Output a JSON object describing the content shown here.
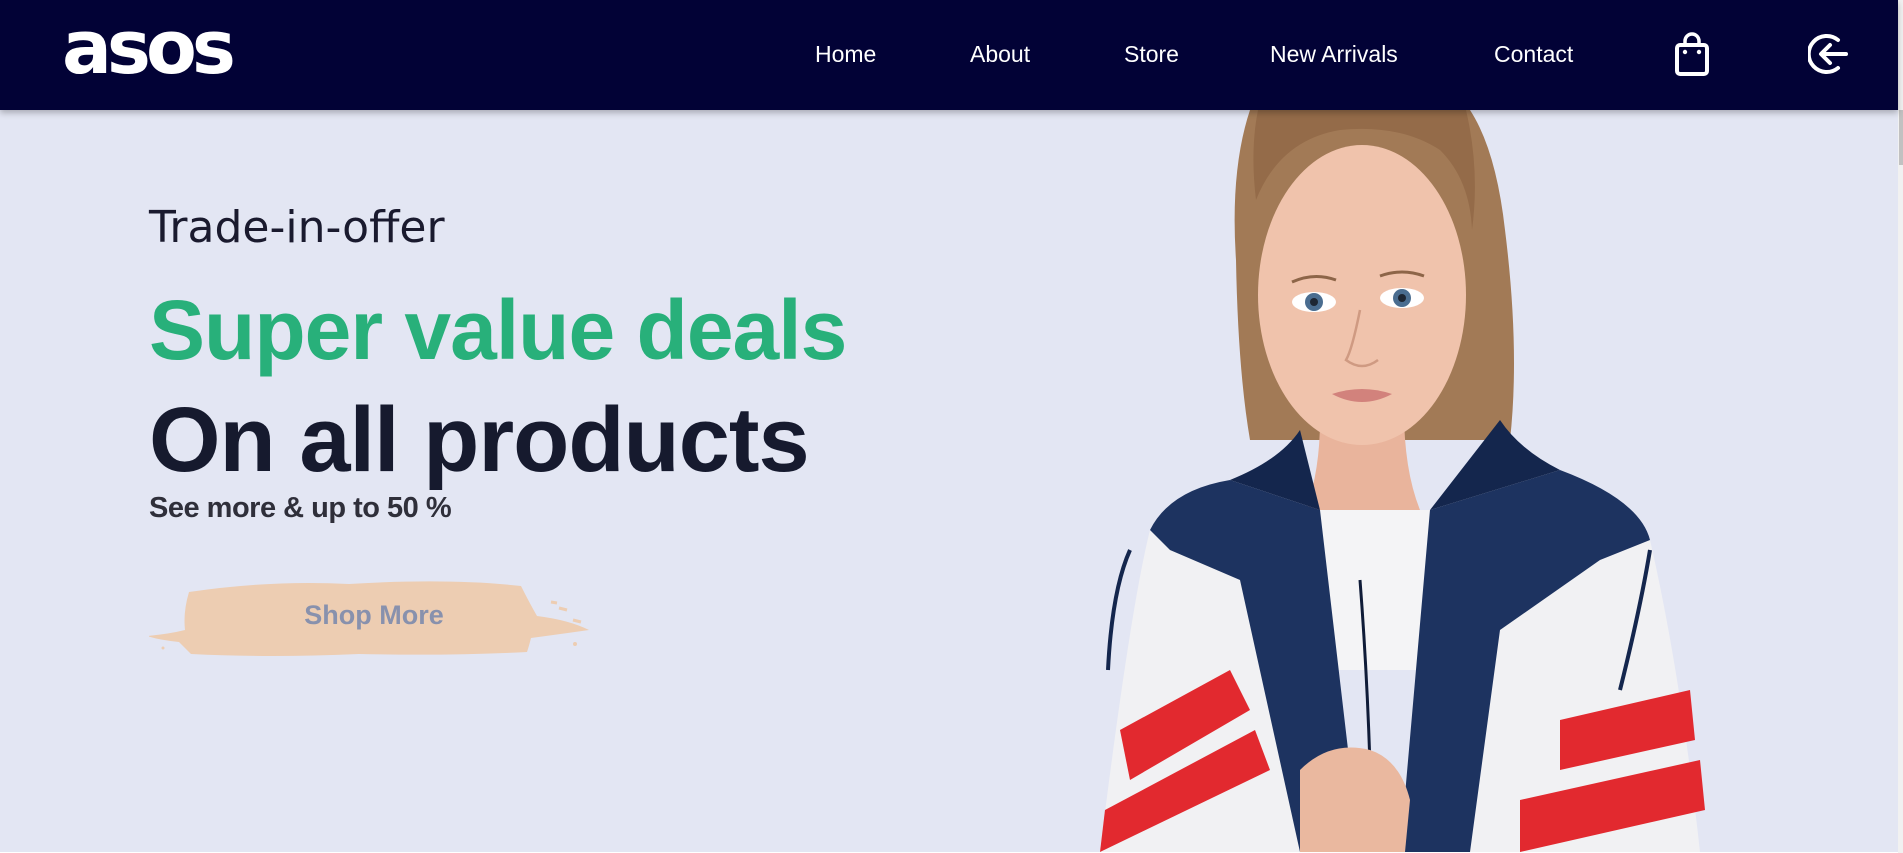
{
  "brand": {
    "logo_text": "asos"
  },
  "nav": {
    "items": [
      {
        "label": "Home"
      },
      {
        "label": "About"
      },
      {
        "label": "Store"
      },
      {
        "label": "New Arrivals"
      },
      {
        "label": "Contact"
      }
    ],
    "icons": {
      "cart": "shopping-bag-icon",
      "login": "arrow-circle-left-icon"
    }
  },
  "hero": {
    "eyebrow": "Trade-in-offer",
    "headline_green": "Super value deals",
    "headline_dark": "On all products",
    "subline": "See more & up to 50 %",
    "cta_label": "Shop More",
    "image": "model-in-tracksuit-jacket"
  },
  "colors": {
    "nav_bg": "#020236",
    "hero_bg": "#e3e6f3",
    "accent_green": "#28b07a",
    "headline_dark": "#161a2e",
    "button_brush": "#edcdb2",
    "button_text": "#8891ad"
  }
}
